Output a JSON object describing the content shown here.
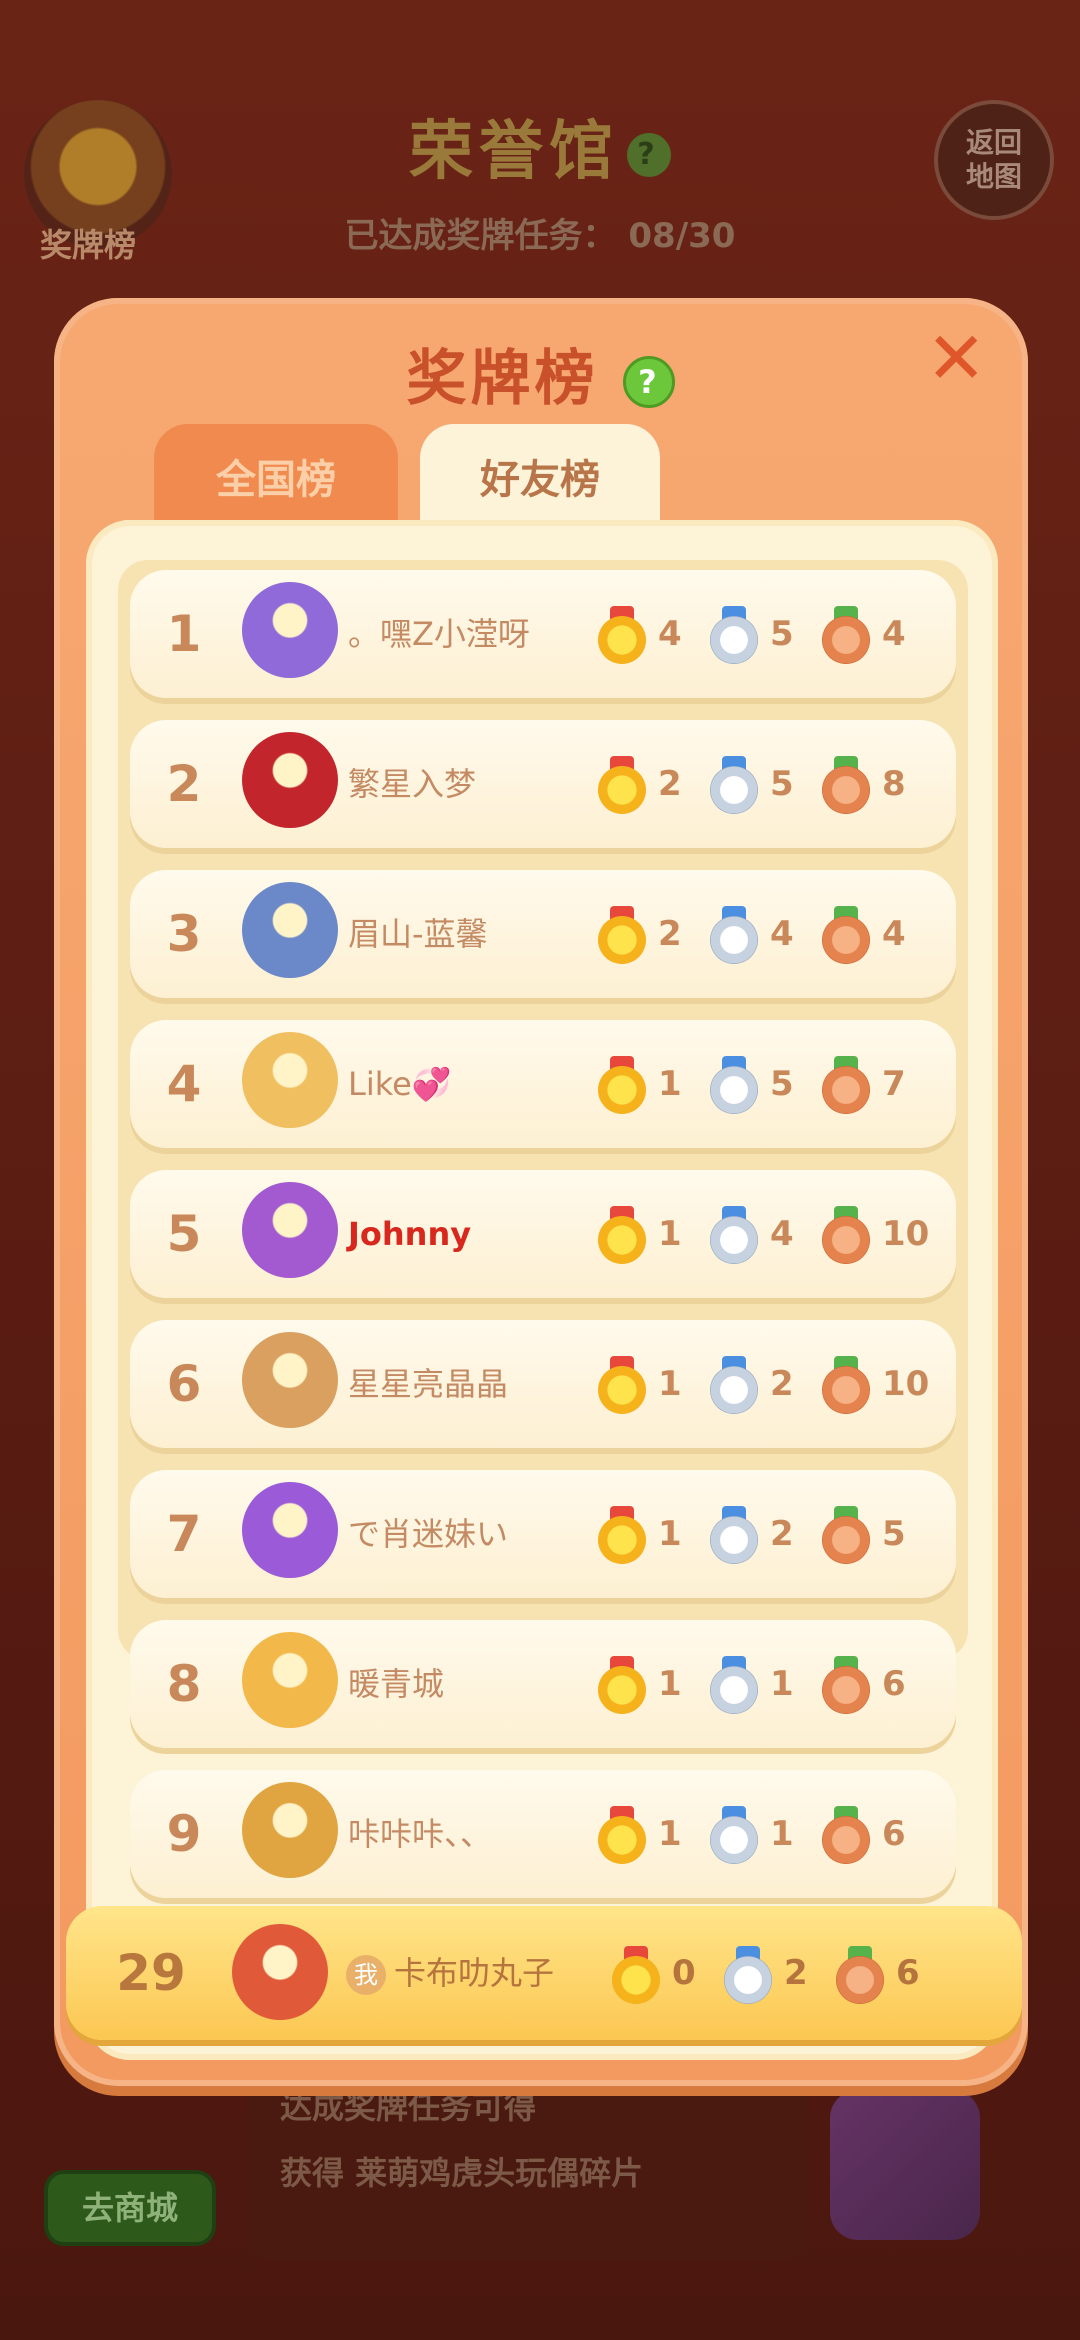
{
  "background": {
    "left_badge_label": "奖牌榜",
    "title": "荣誉馆",
    "help_glyph": "?",
    "subtitle": "已达成奖牌任务： 08/30",
    "right_button": "返回\n地图",
    "shop_button": "去商城",
    "bottom_line_1": "达成奖牌任务可得",
    "bottom_line_2": "获得 莱萌鸡虎头玩偶碎片"
  },
  "modal": {
    "title": "奖牌榜",
    "help_glyph": "?",
    "close_glyph": "✕",
    "tabs": [
      {
        "label": "全国榜",
        "active": false
      },
      {
        "label": "好友榜",
        "active": true
      }
    ]
  },
  "leaderboard": [
    {
      "rank": "1",
      "name": "。嘿Z小滢呀",
      "gold": "4",
      "silver": "5",
      "bronze": "4",
      "avatar_color": "#8f6ad8"
    },
    {
      "rank": "2",
      "name": "繁星入梦",
      "gold": "2",
      "silver": "5",
      "bronze": "8",
      "avatar_color": "#c2262c"
    },
    {
      "rank": "3",
      "name": "眉山-蓝馨",
      "gold": "2",
      "silver": "4",
      "bronze": "4",
      "avatar_color": "#6b88c8"
    },
    {
      "rank": "4",
      "name": "Like💞",
      "gold": "1",
      "silver": "5",
      "bronze": "7",
      "avatar_color": "#f0c060"
    },
    {
      "rank": "5",
      "name": "Johnny",
      "gold": "1",
      "silver": "4",
      "bronze": "10",
      "avatar_color": "#a35ad0",
      "name_color": "#d8281e"
    },
    {
      "rank": "6",
      "name": "星星亮晶晶",
      "gold": "1",
      "silver": "2",
      "bronze": "10",
      "avatar_color": "#d9a060"
    },
    {
      "rank": "7",
      "name": "で肖迷妹い",
      "gold": "1",
      "silver": "2",
      "bronze": "5",
      "avatar_color": "#9b5ad8"
    },
    {
      "rank": "8",
      "name": "暖青城",
      "gold": "1",
      "silver": "1",
      "bronze": "6",
      "avatar_color": "#f2b84a"
    },
    {
      "rank": "9",
      "name": "咔咔咔、、",
      "gold": "1",
      "silver": "1",
      "bronze": "6",
      "avatar_color": "#e0a440"
    }
  ],
  "self": {
    "rank": "29",
    "me_tag": "我",
    "name": "卡布叻丸子",
    "gold": "0",
    "silver": "2",
    "bronze": "6",
    "avatar_color": "#e05a3a"
  }
}
